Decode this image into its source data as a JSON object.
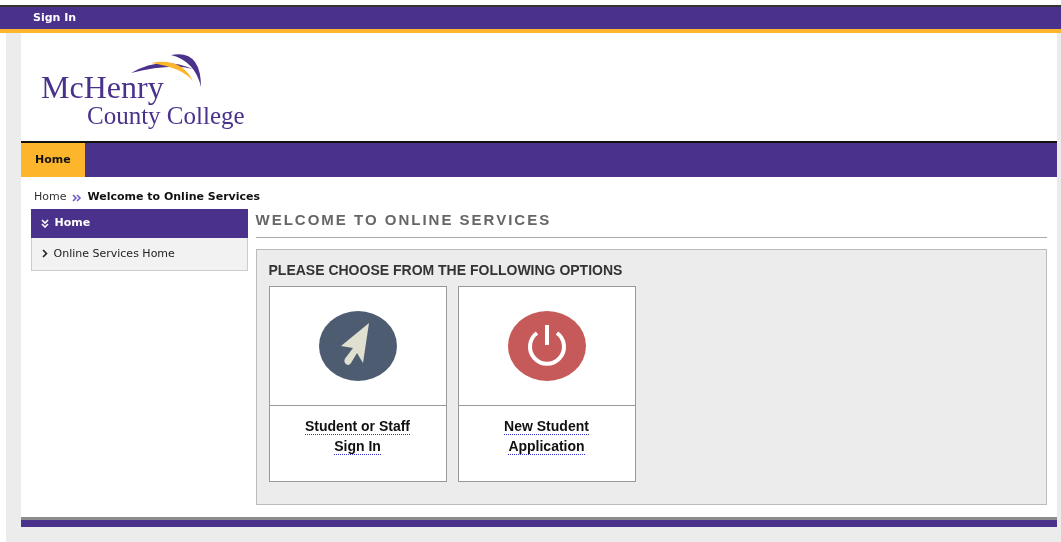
{
  "top_bar": {
    "link": "Sign In"
  },
  "logo": {
    "line_1": "McHenry",
    "line_2": "County College"
  },
  "tabs": [
    {
      "label": "Home",
      "selected": true
    }
  ],
  "breadcrumb": [
    {
      "label": "Home",
      "current": false
    },
    {
      "label": "Welcome to Online Services",
      "current": true
    }
  ],
  "sidebar": {
    "title": "Home",
    "items": [
      {
        "label": "Online Services Home"
      }
    ]
  },
  "page_title": "WELCOME TO ONLINE SERVICES",
  "options_panel": {
    "heading": "PLEASE CHOOSE FROM THE FOLLOWING OPTIONS",
    "options": [
      {
        "kind": "pointer",
        "line_1": "Student or Staff",
        "line_2": "Sign In"
      },
      {
        "kind": "power",
        "line_1": "New Student",
        "line_2": "Application"
      }
    ]
  }
}
